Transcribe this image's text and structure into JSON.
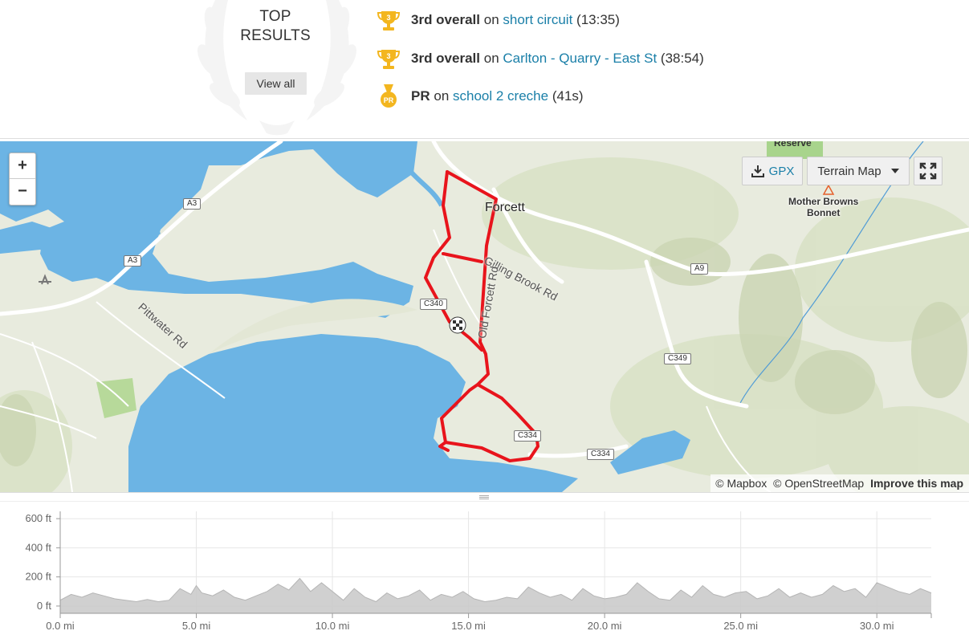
{
  "top_results": {
    "heading_line1": "TOP",
    "heading_line2": "RESULTS",
    "view_all_label": "View all",
    "items": [
      {
        "medal": "trophy-3",
        "rank": "3rd overall",
        "on": "on",
        "segment": "short circuit",
        "time": "(13:35)"
      },
      {
        "medal": "trophy-3",
        "rank": "3rd overall",
        "on": "on",
        "segment": "Carlton - Quarry - East St",
        "time": "(38:54)"
      },
      {
        "medal": "pr-medal",
        "rank": "PR",
        "on": "on",
        "segment": "school 2 creche",
        "time": "(41s)",
        "medal_text": "PR"
      }
    ],
    "trophy_number": "3",
    "medal_color": "#f3b61f"
  },
  "map": {
    "zoom_in": "+",
    "zoom_out": "−",
    "gpx_label": "GPX",
    "style_label": "Terrain Map",
    "town_label": "Forcett",
    "road_names": [
      "Gilling Brook Rd",
      "Old Forcett Rd",
      "Pittwater Rd"
    ],
    "road_shields": [
      "A3",
      "A3",
      "C340",
      "A9",
      "C349",
      "C334",
      "C334"
    ],
    "poi_line1": "Mother Browns",
    "poi_line2": "Bonnet",
    "reserve_label": "Reserve",
    "attribution_mapbox": "© Mapbox",
    "attribution_osm": "© OpenStreetMap",
    "attribution_improve": "Improve this map",
    "water_color": "#6cb4e4",
    "route_color": "#e8141c",
    "icons": [
      "download-icon",
      "caret-down-icon",
      "fullscreen-icon",
      "checkered-flag-icon",
      "airport-icon",
      "peak-icon"
    ]
  },
  "chart_data": {
    "type": "area",
    "title": "",
    "xlabel": "",
    "ylabel": "",
    "x_unit": "mi",
    "y_unit": "ft",
    "xlim": [
      0,
      32
    ],
    "ylim": [
      -50,
      650
    ],
    "x_ticks": [
      "0.0 mi",
      "5.0 mi",
      "10.0 mi",
      "15.0 mi",
      "20.0 mi",
      "25.0 mi",
      "30.0 mi"
    ],
    "x_tick_values": [
      0,
      5,
      10,
      15,
      20,
      25,
      30
    ],
    "y_ticks": [
      "600 ft",
      "400 ft",
      "200 ft",
      "0 ft"
    ],
    "y_tick_values": [
      600,
      400,
      200,
      0
    ],
    "grid": true,
    "fill_color": "#c8c8c8",
    "series": [
      {
        "x": [
          0,
          0.4,
          0.8,
          1.2,
          1.6,
          2.0,
          2.4,
          2.8,
          3.2,
          3.6,
          4.0,
          4.4,
          4.8,
          5.0,
          5.2,
          5.6,
          6.0,
          6.4,
          6.8,
          7.2,
          7.6,
          8.0,
          8.4,
          8.8,
          9.2,
          9.6,
          10.0,
          10.4,
          10.8,
          11.2,
          11.6,
          12.0,
          12.4,
          12.8,
          13.2,
          13.6,
          14.0,
          14.4,
          14.8,
          15.2,
          15.6,
          16.0,
          16.4,
          16.8,
          17.2,
          17.6,
          18.0,
          18.4,
          18.8,
          19.2,
          19.6,
          20.0,
          20.4,
          20.8,
          21.2,
          21.6,
          22.0,
          22.4,
          22.8,
          23.2,
          23.6,
          24.0,
          24.4,
          24.8,
          25.2,
          25.6,
          26.0,
          26.4,
          26.8,
          27.2,
          27.6,
          28.0,
          28.4,
          28.8,
          29.2,
          29.6,
          30.0,
          30.4,
          30.8,
          31.2,
          31.6,
          32.0
        ],
        "y": [
          40,
          80,
          60,
          90,
          70,
          50,
          40,
          30,
          45,
          30,
          40,
          120,
          80,
          140,
          90,
          70,
          110,
          60,
          40,
          70,
          100,
          150,
          110,
          190,
          100,
          160,
          100,
          40,
          120,
          60,
          30,
          90,
          50,
          70,
          110,
          40,
          80,
          60,
          100,
          50,
          30,
          40,
          60,
          50,
          130,
          90,
          60,
          80,
          40,
          120,
          70,
          50,
          60,
          80,
          160,
          100,
          50,
          40,
          110,
          60,
          140,
          80,
          60,
          90,
          100,
          50,
          70,
          120,
          60,
          90,
          60,
          80,
          140,
          100,
          120,
          60,
          160,
          130,
          100,
          80,
          120,
          90
        ]
      }
    ]
  }
}
